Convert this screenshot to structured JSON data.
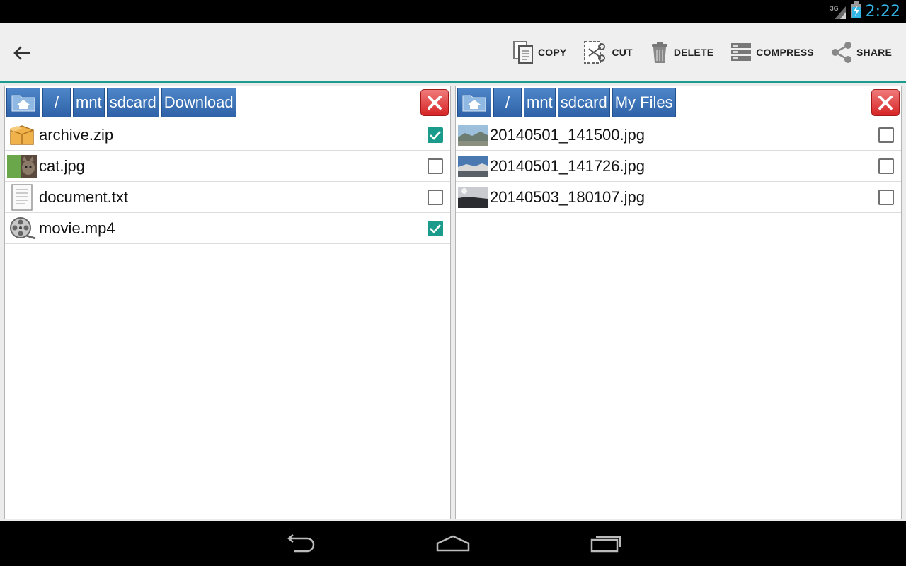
{
  "status_bar": {
    "network": "3G",
    "time": "2:22"
  },
  "toolbar": {
    "actions": [
      {
        "label": "COPY",
        "icon": "copy-icon"
      },
      {
        "label": "CUT",
        "icon": "scissors-icon"
      },
      {
        "label": "DELETE",
        "icon": "trash-icon"
      },
      {
        "label": "COMPRESS",
        "icon": "compress-icon"
      },
      {
        "label": "SHARE",
        "icon": "share-icon"
      }
    ]
  },
  "left_pane": {
    "breadcrumbs": [
      "/",
      "mnt",
      "sdcard",
      "Download"
    ],
    "files": [
      {
        "name": "archive.zip",
        "icon": "archive-icon",
        "checked": true
      },
      {
        "name": "cat.jpg",
        "icon": "image-thumbnail-icon",
        "checked": false
      },
      {
        "name": "document.txt",
        "icon": "text-document-icon",
        "checked": false
      },
      {
        "name": "movie.mp4",
        "icon": "film-reel-icon",
        "checked": true
      }
    ]
  },
  "right_pane": {
    "breadcrumbs": [
      "/",
      "mnt",
      "sdcard",
      "My Files"
    ],
    "files": [
      {
        "name": "20140501_141500.jpg",
        "icon": "image-thumbnail-icon",
        "checked": false
      },
      {
        "name": "20140501_141726.jpg",
        "icon": "image-thumbnail-icon",
        "checked": false
      },
      {
        "name": "20140503_180107.jpg",
        "icon": "image-thumbnail-icon",
        "checked": false
      }
    ]
  },
  "colors": {
    "accent": "#1a9b8c",
    "crumb": "#3a6fb5",
    "close": "#d62424",
    "clock": "#33b5e5"
  }
}
